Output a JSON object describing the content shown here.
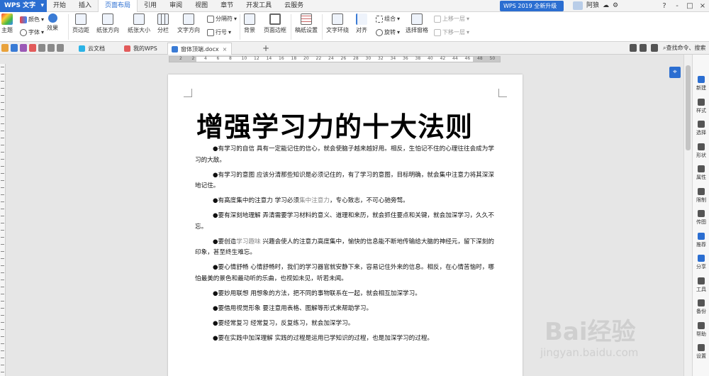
{
  "app": {
    "name": "WPS 文字"
  },
  "menu_tabs": [
    "开始",
    "插入",
    "页面布局",
    "引用",
    "审阅",
    "视图",
    "章节",
    "开发工具",
    "云服务"
  ],
  "active_menu_tab": "页面布局",
  "upgrade_label": "WPS 2019 全新升级",
  "user_name": "阿狼",
  "window_controls": [
    "?",
    "-",
    "□",
    "×"
  ],
  "ribbon": {
    "theme": "主题",
    "colors": "颜色",
    "fonts": "字体",
    "effects": "效果",
    "margins": "页边距",
    "orientation": "纸张方向",
    "size": "纸张大小",
    "columns": "分栏",
    "text_direction": "文字方向",
    "breaks": "分隔符",
    "line_numbers": "行号",
    "background": "背景",
    "page_borders": "页面边框",
    "paper_setup": "稿纸设置",
    "wrap_text": "文字环绕",
    "align": "对齐",
    "group": "组合",
    "rotate": "旋转",
    "selection_pane": "选择窗格",
    "bring_forward": "上移一层",
    "send_backward": "下移一层"
  },
  "doc_tabs": [
    {
      "label": "云文档",
      "active": false
    },
    {
      "label": "我的WPS",
      "active": false
    },
    {
      "label": "窗体顶端.docx",
      "active": true
    }
  ],
  "search_command": "查找命令、搜索",
  "ruler_numbers": [
    "2",
    "2",
    "4",
    "6",
    "8",
    "10",
    "12",
    "14",
    "16",
    "18",
    "20",
    "22",
    "24",
    "26",
    "28",
    "30",
    "32",
    "34",
    "36",
    "38",
    "40",
    "42",
    "44",
    "46",
    "48",
    "50"
  ],
  "document": {
    "title": "增强学习力的十大法则",
    "paragraphs": [
      {
        "pre": "●有学习的自信 具有一定能记住的信心，就会使脑子越来越好用。相反，生怕记不住的心理往往会成为学习的大敌。",
        "hl": "",
        "post": ""
      },
      {
        "pre": "●有学习的意图 应该分清那些知识是必须记住的，有了学习的意图，目标明确，就会集中注意力将其深深地记住。",
        "hl": "",
        "post": ""
      },
      {
        "pre": "●有高度集中的注意力 学习必须",
        "hl": "集中注意力",
        "post": "，专心致志，不可心驰旁骛。"
      },
      {
        "pre": "●要有深刻地理解 弄清需要学习材料的意义、道理和来历，就会抓住要点和关键，就会加深学习，久久不忘。",
        "hl": "",
        "post": ""
      },
      {
        "pre": "●要创造",
        "hl": "学习趣味",
        "post": " 兴趣会使人的注意力高度集中，愉快的信息能不断地传输给大脑的神经元，留下深刻的印象，甚至终生难忘。"
      },
      {
        "pre": "●要心情舒畅 心情舒畅时，我们的学习器官就安静下来，容易记住外来的信息。相反，在心情苦恼时，哪怕最美的景色和最动听的乐曲，也视如未见，听若未闻。",
        "hl": "",
        "post": ""
      },
      {
        "pre": "●要妙用联想 用想象的方法，把不同的事物联系在一起，就会相互加深学习。",
        "hl": "",
        "post": ""
      },
      {
        "pre": "●要借用视觉形象 要注意用表格、图解等形式来帮助学习。",
        "hl": "",
        "post": ""
      },
      {
        "pre": "●要经常复习 经常复习，反复练习，就会加深学习。",
        "hl": "",
        "post": ""
      },
      {
        "pre": "●要在实践中加深理解 实践的过程是运用已学知识的过程，也是加深学习的过程。",
        "hl": "",
        "post": ""
      }
    ]
  },
  "right_pane": [
    "新建",
    "样式",
    "选择",
    "形状",
    "属性",
    "限制",
    "传图",
    "推荐",
    "分享",
    "工具",
    "备份",
    "帮助",
    "设置"
  ],
  "watermark": {
    "brand": "Bai经验",
    "url": "jingyan.baidu.com"
  },
  "colors": {
    "accent": "#2b6ed1",
    "highlight_text": "#888888"
  }
}
